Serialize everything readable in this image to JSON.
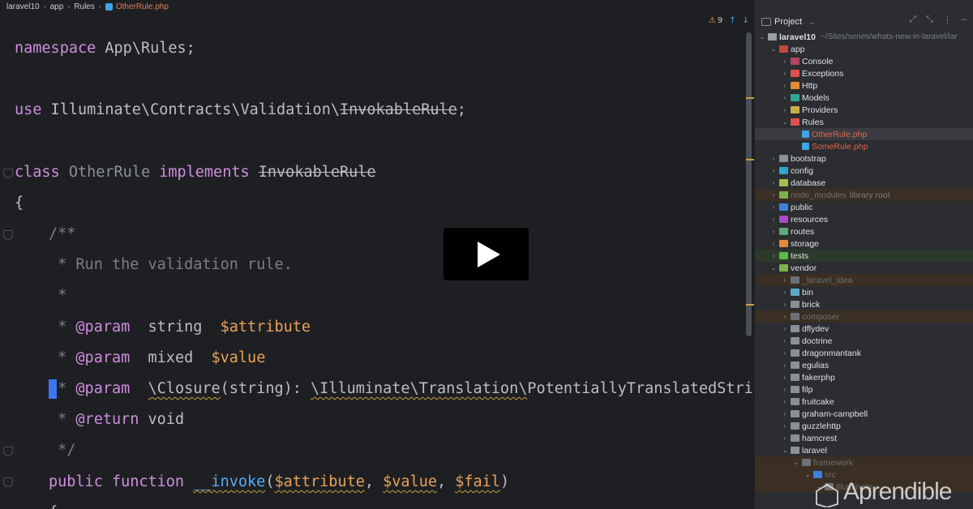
{
  "breadcrumb": [
    "laravel10",
    "app",
    "Rules",
    "OtherRule.php"
  ],
  "editor_status": {
    "warnings": "9"
  },
  "code": {
    "l1": {
      "kw": "namespace",
      "rest": " App\\Rules;"
    },
    "l2": {
      "kw": "use",
      "rest": " Illuminate\\Contracts\\Validation\\",
      "del": "InvokableRule",
      "end": ";"
    },
    "l3": {
      "kw": "class",
      "cls": " OtherRule ",
      "kw2": "implements",
      "sp": " ",
      "del": "InvokableRule"
    },
    "l4": "{",
    "l5": "/**",
    "l6": " * Run the validation rule.",
    "l7": " *",
    "l8": {
      "pre": " * ",
      "tag": "@param",
      "type": "  string  ",
      "var": "$attribute"
    },
    "l9": {
      "pre": " * ",
      "tag": "@param",
      "type": "  mixed  ",
      "var": "$value"
    },
    "l10": {
      "pre": " * ",
      "tag": "@param",
      "sp": "  ",
      "sq": "\\Closure",
      "type": "(string): ",
      "sq2": "\\Illuminate\\Translation\\",
      "rest": "PotentiallyTranslatedString  ",
      "var": "$"
    },
    "l11": {
      "pre": " * ",
      "tag": "@return",
      "type": " void"
    },
    "l12": " */",
    "l13": {
      "kw": "public function ",
      "fn": "__invoke",
      "p1": "(",
      "v1": "$attribute",
      "c1": ", ",
      "v2": "$value",
      "c2": ", ",
      "v3": "$fail",
      "p2": ")"
    },
    "l14": "{"
  },
  "panel": {
    "title": "Project",
    "tree": [
      {
        "label": "laravel10",
        "path": "~/Sites/series/whats-new-in-laravel/lar"
      },
      {
        "label": "app"
      },
      {
        "label": "Console"
      },
      {
        "label": "Exceptions"
      },
      {
        "label": "Http"
      },
      {
        "label": "Models"
      },
      {
        "label": "Providers"
      },
      {
        "label": "Rules"
      },
      {
        "label": "OtherRule.php"
      },
      {
        "label": "SomeRule.php"
      },
      {
        "label": "bootstrap"
      },
      {
        "label": "config"
      },
      {
        "label": "database"
      },
      {
        "label": "node_modules",
        "extra": "library root"
      },
      {
        "label": "public"
      },
      {
        "label": "resources"
      },
      {
        "label": "routes"
      },
      {
        "label": "storage"
      },
      {
        "label": "tests"
      },
      {
        "label": "vendor"
      },
      {
        "label": "_laravel_idea"
      },
      {
        "label": "bin"
      },
      {
        "label": "brick"
      },
      {
        "label": "composer"
      },
      {
        "label": "dflydev"
      },
      {
        "label": "doctrine"
      },
      {
        "label": "dragonmantank"
      },
      {
        "label": "egulias"
      },
      {
        "label": "fakerphp"
      },
      {
        "label": "filp"
      },
      {
        "label": "fruitcake"
      },
      {
        "label": "graham-campbell"
      },
      {
        "label": "guzzlehttp"
      },
      {
        "label": "hamcrest"
      },
      {
        "label": "laravel"
      },
      {
        "label": "framework"
      },
      {
        "label": "src"
      },
      {
        "label": "Illuminate"
      }
    ]
  },
  "watermark": "Aprendible",
  "colors": {
    "accent": "#3d75ec",
    "keyword": "#cf8ee0",
    "variable": "#e8a35a",
    "function": "#57aaf7",
    "active_file": "#e0674a"
  }
}
